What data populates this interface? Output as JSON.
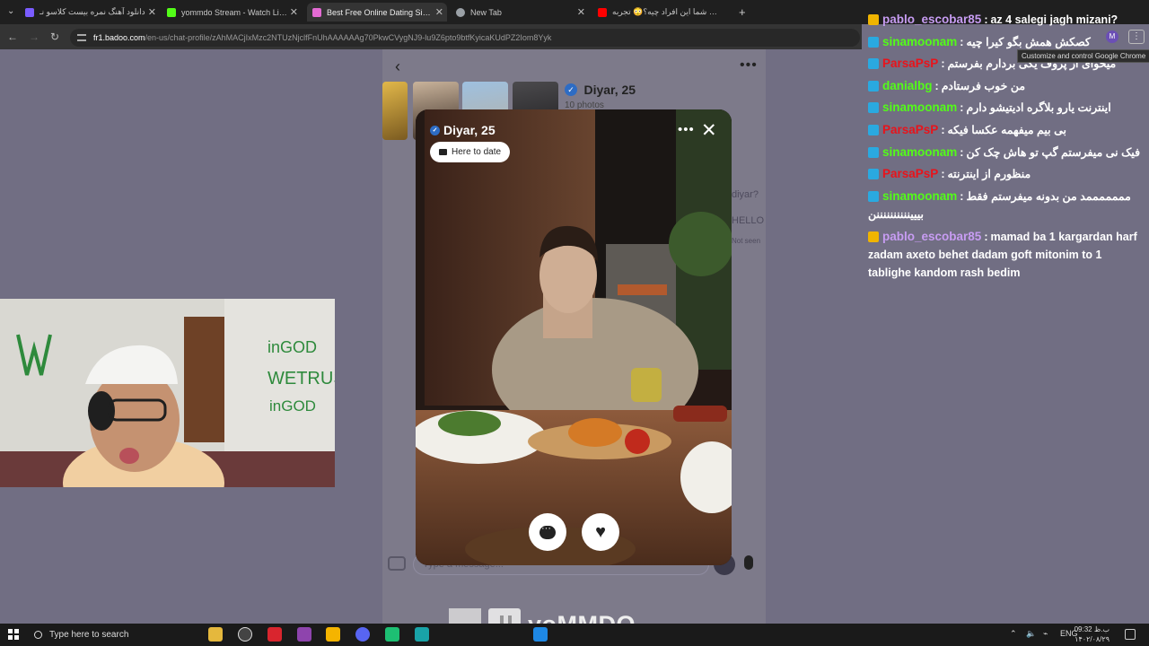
{
  "browser": {
    "tabs": [
      {
        "title": "دانلود آهنگ نمره بیست کلاسو نـ",
        "favicon_color": "#7a5cff"
      },
      {
        "title": "yommdo Stream - Watch Live o",
        "favicon_color": "#53fc18"
      },
      {
        "title": "Best Free Online Dating Site &",
        "favicon_color": "#e36ad3"
      },
      {
        "title": "New Tab",
        "favicon_color": "#9aa0a6"
      },
      {
        "title": "نظر شما این افراد چیه؟😳 تجربه",
        "favicon_color": "#ff0000"
      }
    ],
    "active_tab": 2,
    "url_host": "fr1.badoo.com",
    "url_path": "/en-us/chat-profile/zAhMACjIxMzc2NTUzNjclfFnUhAAAAAAg70PkwCVygNJ9-lu9Z6pto9btfKyicaKUdPZ2Iom8Yyk",
    "tooltip": "Customize and control Google Chrome",
    "profile_initial": "M"
  },
  "profile": {
    "name_age": "Diyar, 25",
    "photo_count": "10 photos",
    "badge_label": "Here to date",
    "verified": true
  },
  "chat_page": {
    "input_placeholder": "Type a message...",
    "bubble_1": "diyar?",
    "bubble_2": "HELLO",
    "seen_status": "Not seen"
  },
  "stream_chat": {
    "messages": [
      {
        "user": "pablo_escobar85",
        "user_color": "#c79cf2",
        "badge_color": "#f0b400",
        "text": "az 4 salegi jagh mizani?"
      },
      {
        "user": "sinamoonam",
        "user_color": "#53fc18",
        "badge_color": "#2aa9e0",
        "text": "کصکش همش بگو کیرا چیه"
      },
      {
        "user": "ParsaPsP",
        "user_color": "#e8131b",
        "badge_color": "#2aa9e0",
        "text": "میخوای از پروف یکی بردارم بفرستم"
      },
      {
        "user": "danialbg",
        "user_color": "#53fc18",
        "badge_color": "#2aa9e0",
        "text": "من خوب فرستادم"
      },
      {
        "user": "sinamoonam",
        "user_color": "#53fc18",
        "badge_color": "#2aa9e0",
        "text": "اینترنت یارو بلاگره ادیتیشو دارم"
      },
      {
        "user": "ParsaPsP",
        "user_color": "#e8131b",
        "badge_color": "#2aa9e0",
        "text": "بی بیم میفهمه عکسا فیکه"
      },
      {
        "user": "sinamoonam",
        "user_color": "#53fc18",
        "badge_color": "#2aa9e0",
        "text": "فیک نی میفرستم گپ تو هاش چک کن"
      },
      {
        "user": "ParsaPsP",
        "user_color": "#e8131b",
        "badge_color": "#2aa9e0",
        "text": "منظورم از اینترنته"
      },
      {
        "user": "sinamoonam",
        "user_color": "#53fc18",
        "badge_color": "#2aa9e0",
        "text": "مممممممد من بدونه میفرستم فقط بیییننننننننننن"
      },
      {
        "user": "pablo_escobar85",
        "user_color": "#c79cf2",
        "badge_color": "#f0b400",
        "text": "mamad ba 1 kargardan harf zadam axeto behet dadam goft mitonim to 1 tablighe kandom rash bedim"
      }
    ]
  },
  "watermark": {
    "text": "yoMMDO"
  },
  "taskbar": {
    "search_placeholder": "Type here to search",
    "language": "ENG",
    "time": "09:32 ب.ظ",
    "date": "۱۴۰۲/۰۸/۲۹"
  }
}
